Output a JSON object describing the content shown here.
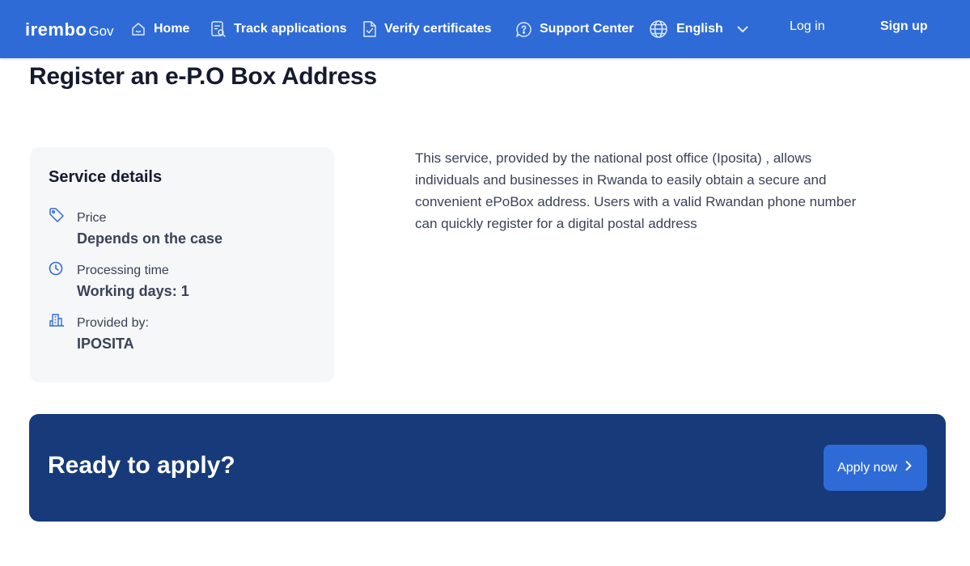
{
  "header": {
    "logo_main": "irembo",
    "logo_sub": "Gov",
    "nav": {
      "home": "Home",
      "track": "Track applications",
      "verify": "Verify certificates",
      "support": "Support Center",
      "language": "English"
    },
    "login": "Log in",
    "signup": "Sign up"
  },
  "page": {
    "title": "Register an e-P.O Box Address"
  },
  "service_details": {
    "title": "Service details",
    "price_label": "Price",
    "price_value": "Depends on the case",
    "time_label": "Processing time",
    "time_value": "Working days: 1",
    "provider_label": "Provided by:",
    "provider_value": "IPOSITA"
  },
  "description": "This service, provided by the national post office (Iposita) , allows individuals and businesses in Rwanda to easily obtain a secure and convenient ePoBox address. Users with a valid Rwandan phone number can quickly register for a digital postal address",
  "apply": {
    "title": "Ready to apply?",
    "button": "Apply now"
  },
  "colors": {
    "header_bg": "#2f6bd6",
    "banner_bg": "#173a7a",
    "card_bg": "#f6f7f9",
    "accent_icon": "#2f6bd6"
  },
  "icons": [
    "home-icon",
    "track-icon",
    "verify-icon",
    "support-icon",
    "globe-icon",
    "chevron-down-icon",
    "tag-icon",
    "clock-icon",
    "building-icon",
    "chevron-right-icon"
  ]
}
